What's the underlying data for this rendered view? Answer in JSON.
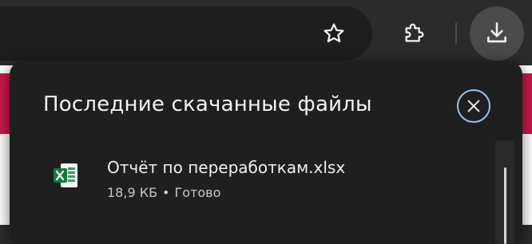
{
  "toolbar": {
    "star_icon": "star-outline-icon",
    "extensions_icon": "puzzle-icon",
    "downloads_icon": "download-icon"
  },
  "downloads_panel": {
    "title": "Последние скачанные файлы",
    "close_icon": "close-icon",
    "accent_color": "#9cc3ea",
    "items": [
      {
        "filename": "Отчёт по переработкам.xlsx",
        "size": "18,9 КБ",
        "separator": "•",
        "status": "Готово",
        "icon": "excel-file-icon"
      }
    ]
  }
}
